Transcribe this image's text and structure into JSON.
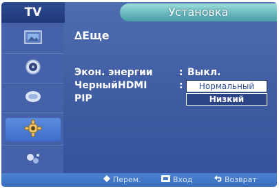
{
  "header": {
    "source": "TV",
    "menu_title": "Установка"
  },
  "sidebar": {
    "items": [
      {
        "icon": "picture-icon"
      },
      {
        "icon": "sound-icon"
      },
      {
        "icon": "channel-icon"
      },
      {
        "icon": "setup-gear-icon",
        "active": true
      },
      {
        "icon": "input-icon"
      }
    ]
  },
  "main": {
    "section_title": "∆Еще",
    "rows": [
      {
        "label": "Экон. энергии",
        "value": "Выкл."
      },
      {
        "label": "ЧерныйHDMI",
        "value": ""
      },
      {
        "label": "PIP",
        "value": ""
      }
    ],
    "separator": ":",
    "hdmi_options": {
      "selected": "Нормальный",
      "other": "Низкий"
    }
  },
  "footer": {
    "move": "Перем.",
    "enter": "Вход",
    "return": "Возврат"
  },
  "colors": {
    "background": "#3d5aa1",
    "title_bar": "#6cbcc0",
    "active_item": "#4f7ed8",
    "footer": "#4278c8"
  }
}
